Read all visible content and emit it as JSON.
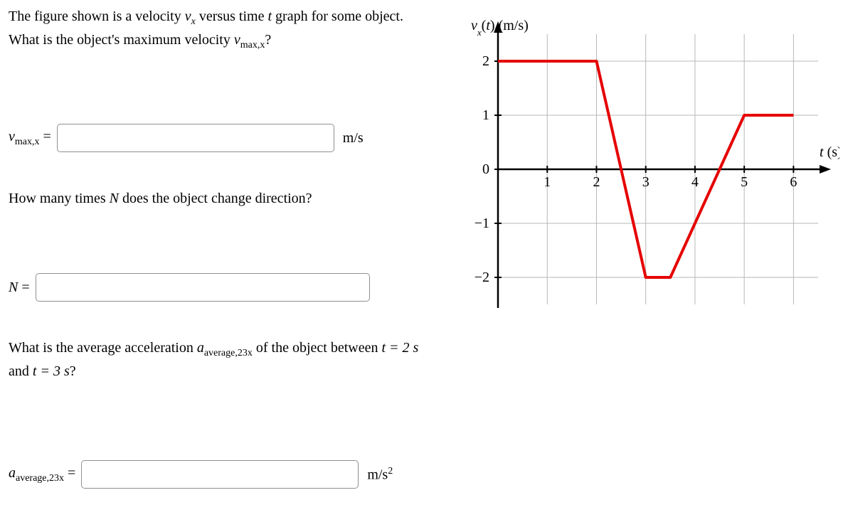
{
  "q1": {
    "prompt_a": "The figure shown is a velocity ",
    "prompt_b": " versus time ",
    "prompt_c": " graph for some object. What is the object's maximum velocity ",
    "prompt_d": "?",
    "var_vx": "v",
    "var_vx_sub": "x",
    "var_t": "t",
    "var_vmax": "v",
    "var_vmax_sub": "max,x",
    "label_eq": " =",
    "unit": "m/s",
    "value": ""
  },
  "q2": {
    "prompt": "How many times ",
    "var_N": "N",
    "prompt_b": " does the object change direction?",
    "label": "N",
    "label_eq": " =",
    "value": ""
  },
  "q3": {
    "prompt_a": "What is the average acceleration ",
    "var_a": "a",
    "var_a_sub": "average,23x",
    "prompt_b": " of the object between ",
    "eq1": "t = 2 s",
    "and": " and ",
    "eq2": "t = 3 s",
    "prompt_c": "?",
    "label_eq": " =",
    "unit_a": "m/s",
    "unit_exp": "2",
    "value": ""
  },
  "chart_data": {
    "type": "line",
    "title": "",
    "xlabel": "t (s)",
    "ylabel": "v_x(t) (m/s)",
    "xlim": [
      0,
      6.5
    ],
    "ylim": [
      -2.5,
      2.5
    ],
    "xticks": [
      1,
      2,
      3,
      4,
      5,
      6
    ],
    "yticks": [
      -2,
      -1,
      0,
      1,
      2
    ],
    "series": [
      {
        "name": "v_x",
        "color": "#e60000",
        "points": [
          {
            "t": 0.0,
            "v": 2.0
          },
          {
            "t": 2.0,
            "v": 2.0
          },
          {
            "t": 3.0,
            "v": -2.0
          },
          {
            "t": 3.5,
            "v": -2.0
          },
          {
            "t": 5.0,
            "v": 1.0
          },
          {
            "t": 6.0,
            "v": 1.0
          }
        ]
      }
    ]
  }
}
